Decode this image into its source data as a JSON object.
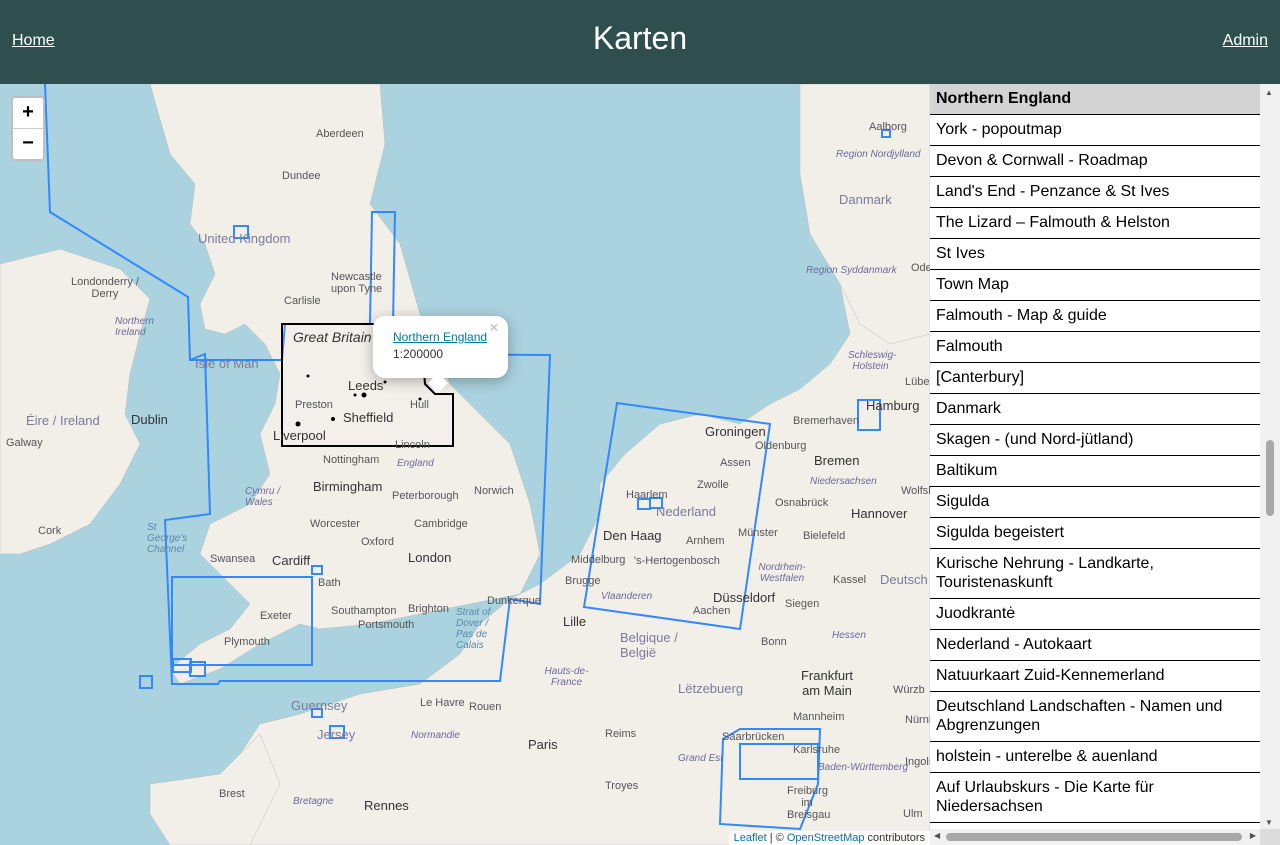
{
  "header": {
    "home": "Home",
    "title": "Karten",
    "admin": "Admin"
  },
  "map": {
    "zoom_in": "+",
    "zoom_out": "−",
    "popup": {
      "link": "Northern England",
      "scale": "1:200000",
      "close": "×"
    },
    "attribution": {
      "leaflet": "Leaflet",
      "sep": " | © ",
      "osm": "OpenStreetMap",
      "suffix": " contributors"
    },
    "labels": {
      "aberdeen": "Aberdeen",
      "dundee": "Dundee",
      "united_kingdom": "United Kingdom",
      "londonderry": "Londonderry / Derry",
      "northern_ireland": "Northern Ireland",
      "newcastle": "Newcastle upon Tyne",
      "carlisle": "Carlisle",
      "isle_of_man": "Isle of Man",
      "great_britain": "Great Britain",
      "leeds": "Leeds",
      "preston": "Preston",
      "sheffield": "Sheffield",
      "hull": "Hull",
      "liverpool": "Liverpool",
      "lincoln": "Lincoln",
      "eire": "Éire / Ireland",
      "dublin": "Dublin",
      "galway": "Galway",
      "nottingham": "Nottingham",
      "england": "England",
      "cymru": "Cymru / Wales",
      "birmingham": "Birmingham",
      "peterborough": "Peterborough",
      "norwich": "Norwich",
      "cork": "Cork",
      "st_georges": "St George's Channel",
      "worcester": "Worcester",
      "oxford": "Oxford",
      "cambridge": "Cambridge",
      "swansea": "Swansea",
      "cardiff": "Cardiff",
      "london": "London",
      "bath": "Bath",
      "exeter": "Exeter",
      "southampton": "Southampton",
      "brighton": "Brighton",
      "portsmouth": "Portsmouth",
      "plymouth": "Plymouth",
      "dunkerque": "Dunkerque",
      "strait_dover": "Strait of Dover / Pas de Calais",
      "lille": "Lille",
      "brugge": "Brugge",
      "middelburg": "Middelburg",
      "den_haag": "Den Haag",
      "haarlem": "Haarlem",
      "nederland": "Nederland",
      "arnhem": "Arnhem",
      "zwolle": "Zwolle",
      "assen": "Assen",
      "groningen": "Groningen",
      "oldenburg": "Oldenburg",
      "bremen": "Bremen",
      "bremerhaven": "Bremerhaven",
      "hamburg": "Hamburg",
      "hannover": "Hannover",
      "osnabruck": "Osnabrück",
      "bielefeld": "Bielefeld",
      "munster": "Münster",
      "dusseldorf": "Düsseldorf",
      "siegen": "Siegen",
      "kassel": "Kassel",
      "aachen": "Aachen",
      "bonn": "Bonn",
      "hertogenbosch": "'s-Hertogenbosch",
      "vlaanderen": "Vlaanderen",
      "belgique": "Belgique / België",
      "letzebuerg": "Lëtzebuerg",
      "hauts_de_france": "Hauts-de-France",
      "frankfurt": "Frankfurt am Main",
      "mannheim": "Mannheim",
      "saarbrucken": "Saarbrücken",
      "karlsruhe": "Karlsruhe",
      "baden": "Baden-Württemberg",
      "freiburg": "Freiburg im Breisgau",
      "reims": "Reims",
      "paris": "Paris",
      "grand_est": "Grand Est",
      "troyes": "Troyes",
      "rouen": "Rouen",
      "le_havre": "Le Havre",
      "normandie": "Normandie",
      "guernsey": "Guernsey",
      "jersey": "Jersey",
      "rennes": "Rennes",
      "brest": "Brest",
      "bretagne": "Bretagne",
      "danmark": "Danmark",
      "aalborg": "Aalborg",
      "region_nordjylland": "Region Nordjylland",
      "region_syddanmark": "Region Syddanmark",
      "odense": "Ode",
      "schleswig": "Schleswig-Holstein",
      "lubeck": "Lübeck",
      "niedersachsen": "Niedersachsen",
      "nordrhein": "Nordrhein-Westfalen",
      "deutsch": "Deutsch",
      "wolfsb": "Wolfsb",
      "hessen": "Hessen",
      "wurzb": "Würzb",
      "ingols": "Ingols",
      "nurnberg": "Nürnb",
      "lower_right": "Ulm"
    }
  },
  "sidebar": {
    "items": [
      "Northern England",
      "York - popoutmap",
      "Devon & Cornwall - Roadmap",
      "Land's End - Penzance & St Ives",
      "The Lizard – Falmouth & Helston",
      "St Ives",
      "Town Map",
      "Falmouth - Map & guide",
      "Falmouth",
      "[Canterbury]",
      "Danmark",
      "Skagen - (und Nord-jütland)",
      "Baltikum",
      "Sigulda",
      "Sigulda begeistert",
      "Kurische Nehrung - Landkarte, Touristenaskunft",
      "Juodkrantė",
      "Nederland - Autokaart",
      "Natuurkaart Zuid-Kennemerland",
      "Deutschland Landschaften - Namen und Abgrenzungen",
      "holstein - unterelbe & auenland",
      "Auf Urlaubskurs - Die Karte für Niedersachsen"
    ]
  }
}
